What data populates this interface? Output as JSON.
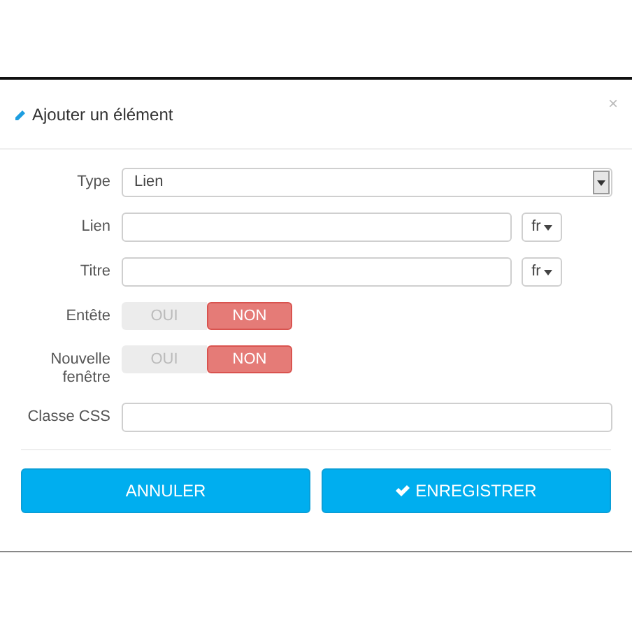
{
  "dialog": {
    "title": "Ajouter un élément",
    "close": "×"
  },
  "fields": [
    {
      "kind": "select",
      "label": "Type",
      "value": "Lien"
    },
    {
      "kind": "lang",
      "label": "Lien",
      "lang": "fr"
    },
    {
      "kind": "lang",
      "label": "Titre",
      "lang": "fr"
    },
    {
      "kind": "toggle",
      "label": "Entête",
      "options": [
        {
          "label": "OUI",
          "selected": false
        },
        {
          "label": "NON",
          "selected": true
        }
      ]
    },
    {
      "kind": "toggle",
      "label": "Nouvelle fenêtre",
      "options": [
        {
          "label": "OUI",
          "selected": false
        },
        {
          "label": "NON",
          "selected": true
        }
      ]
    },
    {
      "kind": "text",
      "label": "Classe CSS"
    }
  ],
  "buttons": [
    {
      "label": "ANNULER",
      "kind": "cancel"
    },
    {
      "label": "ENREGISTRER",
      "kind": "save"
    }
  ]
}
